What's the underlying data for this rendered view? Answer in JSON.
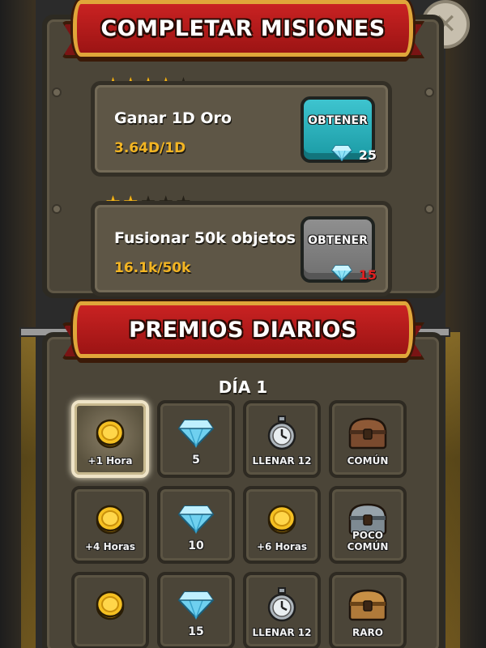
{
  "missions_title": "COMPLETAR MISIONES",
  "daily_title": "PREMIOS DIARIOS",
  "close_symbol": "✕",
  "star_glyph": "★",
  "missions": [
    {
      "name": "Ganar 1D Oro",
      "progress": "3.64D/1D",
      "stars_filled": 4,
      "stars_total": 5,
      "button_label": "OBTENER",
      "button_state": "active",
      "cost": "25",
      "cost_color": "#ffffff"
    },
    {
      "name": "Fusionar 50k objetos",
      "progress": "16.1k/50k",
      "stars_filled": 2,
      "stars_total": 5,
      "button_label": "OBTENER",
      "button_state": "disabled",
      "cost": "15",
      "cost_color": "#e02020"
    }
  ],
  "day_label": "DÍA 1",
  "rewards": [
    {
      "icon": "coin-icon",
      "label": "+1 Hora",
      "highlight": true
    },
    {
      "icon": "diamond-icon",
      "label": "5"
    },
    {
      "icon": "stopwatch-icon",
      "label": "LLENAR 12"
    },
    {
      "icon": "chest-common-icon",
      "label": "COMÚN"
    },
    {
      "icon": "coin-icon",
      "label": "+4 Horas"
    },
    {
      "icon": "diamond-icon",
      "label": "10"
    },
    {
      "icon": "coin-icon",
      "label": "+6 Horas"
    },
    {
      "icon": "chest-uncommon-icon",
      "label": "POCO COMÚN"
    },
    {
      "icon": "coin-icon",
      "label": ""
    },
    {
      "icon": "diamond-icon",
      "label": "15"
    },
    {
      "icon": "stopwatch-icon",
      "label": "LLENAR 12"
    },
    {
      "icon": "chest-rare-icon",
      "label": "RARO"
    }
  ],
  "colors": {
    "banner_red": "#c92222",
    "banner_gold": "#e0a63a",
    "progress_gold": "#f3b523",
    "button_teal": "#3ec4cf",
    "button_gray": "#8f8f8f",
    "cost_insufficient": "#e02020"
  }
}
